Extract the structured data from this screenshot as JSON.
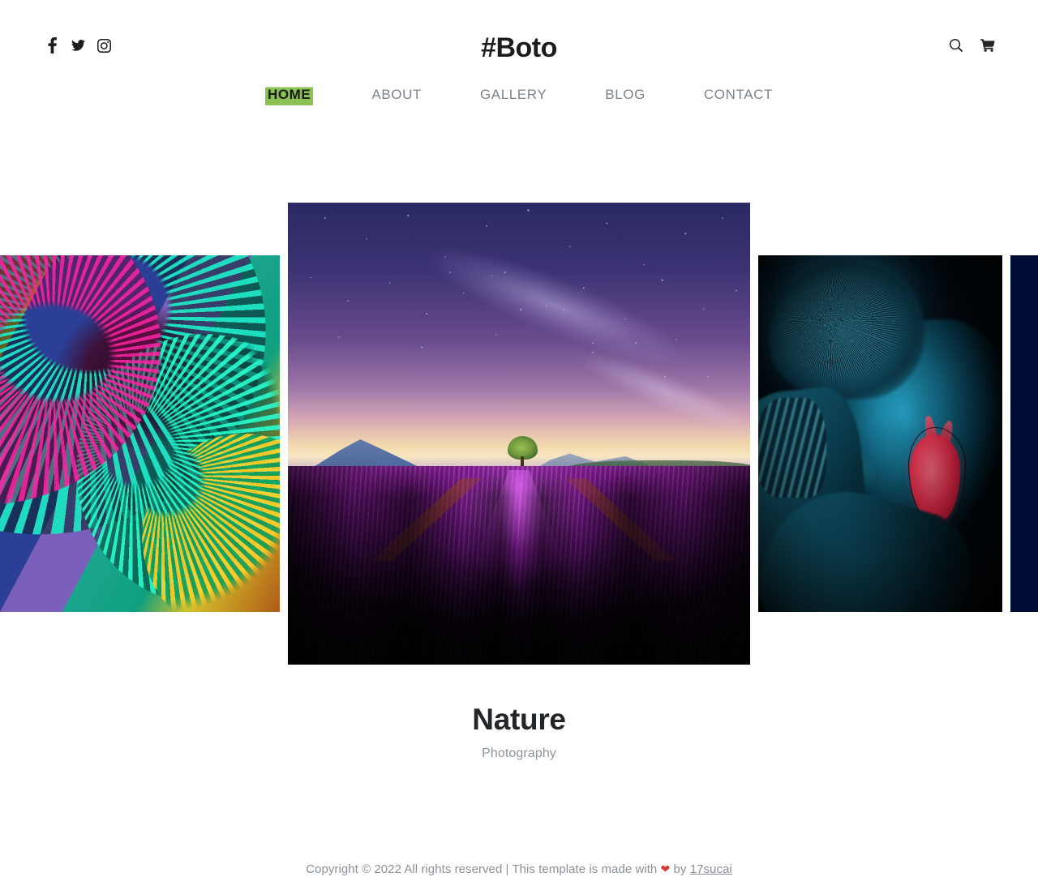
{
  "header": {
    "brand": "#Boto",
    "social": [
      {
        "name": "facebook-icon",
        "label": "Facebook"
      },
      {
        "name": "twitter-icon",
        "label": "Twitter"
      },
      {
        "name": "instagram-icon",
        "label": "Instagram"
      }
    ],
    "tools": [
      {
        "name": "search-icon",
        "label": "Search"
      },
      {
        "name": "cart-icon",
        "label": "Cart"
      }
    ],
    "nav": [
      {
        "label": "HOME",
        "active": true
      },
      {
        "label": "ABOUT",
        "active": false
      },
      {
        "label": "GALLERY",
        "active": false
      },
      {
        "label": "BLOG",
        "active": false
      },
      {
        "label": "CONTACT",
        "active": false
      }
    ],
    "active_highlight_color": "#8cc153",
    "nav_color": "#7b848b"
  },
  "carousel": {
    "slides": [
      {
        "name": "slide-slinky",
        "alt": "Colorful slinky spiral toy in pink, teal and yellow"
      },
      {
        "name": "slide-lavender",
        "alt": "Lavender field at night under the Milky Way with a lone tree"
      },
      {
        "name": "slide-bodypaint",
        "alt": "Blue-lit portrait with a painted red anatomical heart"
      },
      {
        "name": "slide-next-partial",
        "alt": "Dark navy next slide edge"
      }
    ],
    "active_index": 1
  },
  "caption": {
    "title": "Nature",
    "subtitle": "Photography"
  },
  "footer": {
    "text_before": "Copyright © 2022 All rights reserved | This template is made with",
    "heart": "❤",
    "text_between": "by",
    "link": "17sucai"
  }
}
